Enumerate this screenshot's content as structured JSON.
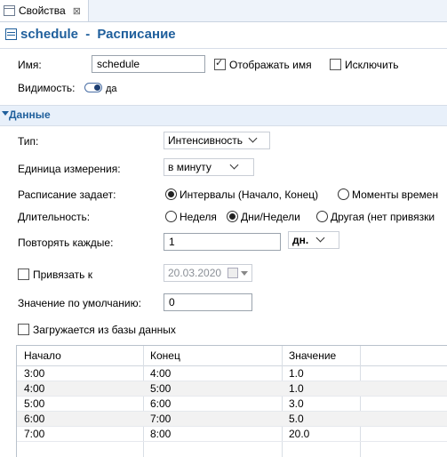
{
  "tab": {
    "label": "Свойства",
    "close": "⊠"
  },
  "header": {
    "name": "schedule",
    "separator": " - ",
    "type": "Расписание"
  },
  "general": {
    "name_label": "Имя:",
    "name_value": "schedule",
    "show_name_label": "Отображать имя",
    "show_name_checked": true,
    "exclude_label": "Исключить",
    "exclude_checked": false,
    "visibility_label": "Видимость:",
    "visibility_value": "да"
  },
  "section": {
    "title": "Данные"
  },
  "fields": {
    "type_label": "Тип:",
    "type_value": "Интенсивность",
    "unit_label": "Единица измерения:",
    "unit_value": "в минуту",
    "defines_label": "Расписание задает:",
    "defines_opt1": "Интервалы (Начало, Конец)",
    "defines_opt2": "Моменты времен",
    "duration_label": "Длительность:",
    "duration_opt1": "Неделя",
    "duration_opt2": "Дни/Недели",
    "duration_opt3": "Другая (нет привязки",
    "repeat_label": "Повторять каждые:",
    "repeat_value": "1",
    "repeat_unit": "дн.",
    "bind_label": "Привязать к",
    "bind_date": "20.03.2020",
    "default_label": "Значение по умолчанию:",
    "default_value": "0",
    "db_label": "Загружается из базы данных"
  },
  "table": {
    "headers": [
      "Начало",
      "Конец",
      "Значение"
    ],
    "rows": [
      [
        "3:00",
        "4:00",
        "1.0"
      ],
      [
        "4:00",
        "5:00",
        "1.0"
      ],
      [
        "5:00",
        "6:00",
        "3.0"
      ],
      [
        "6:00",
        "7:00",
        "5.0"
      ],
      [
        "7:00",
        "8:00",
        "20.0"
      ]
    ]
  }
}
